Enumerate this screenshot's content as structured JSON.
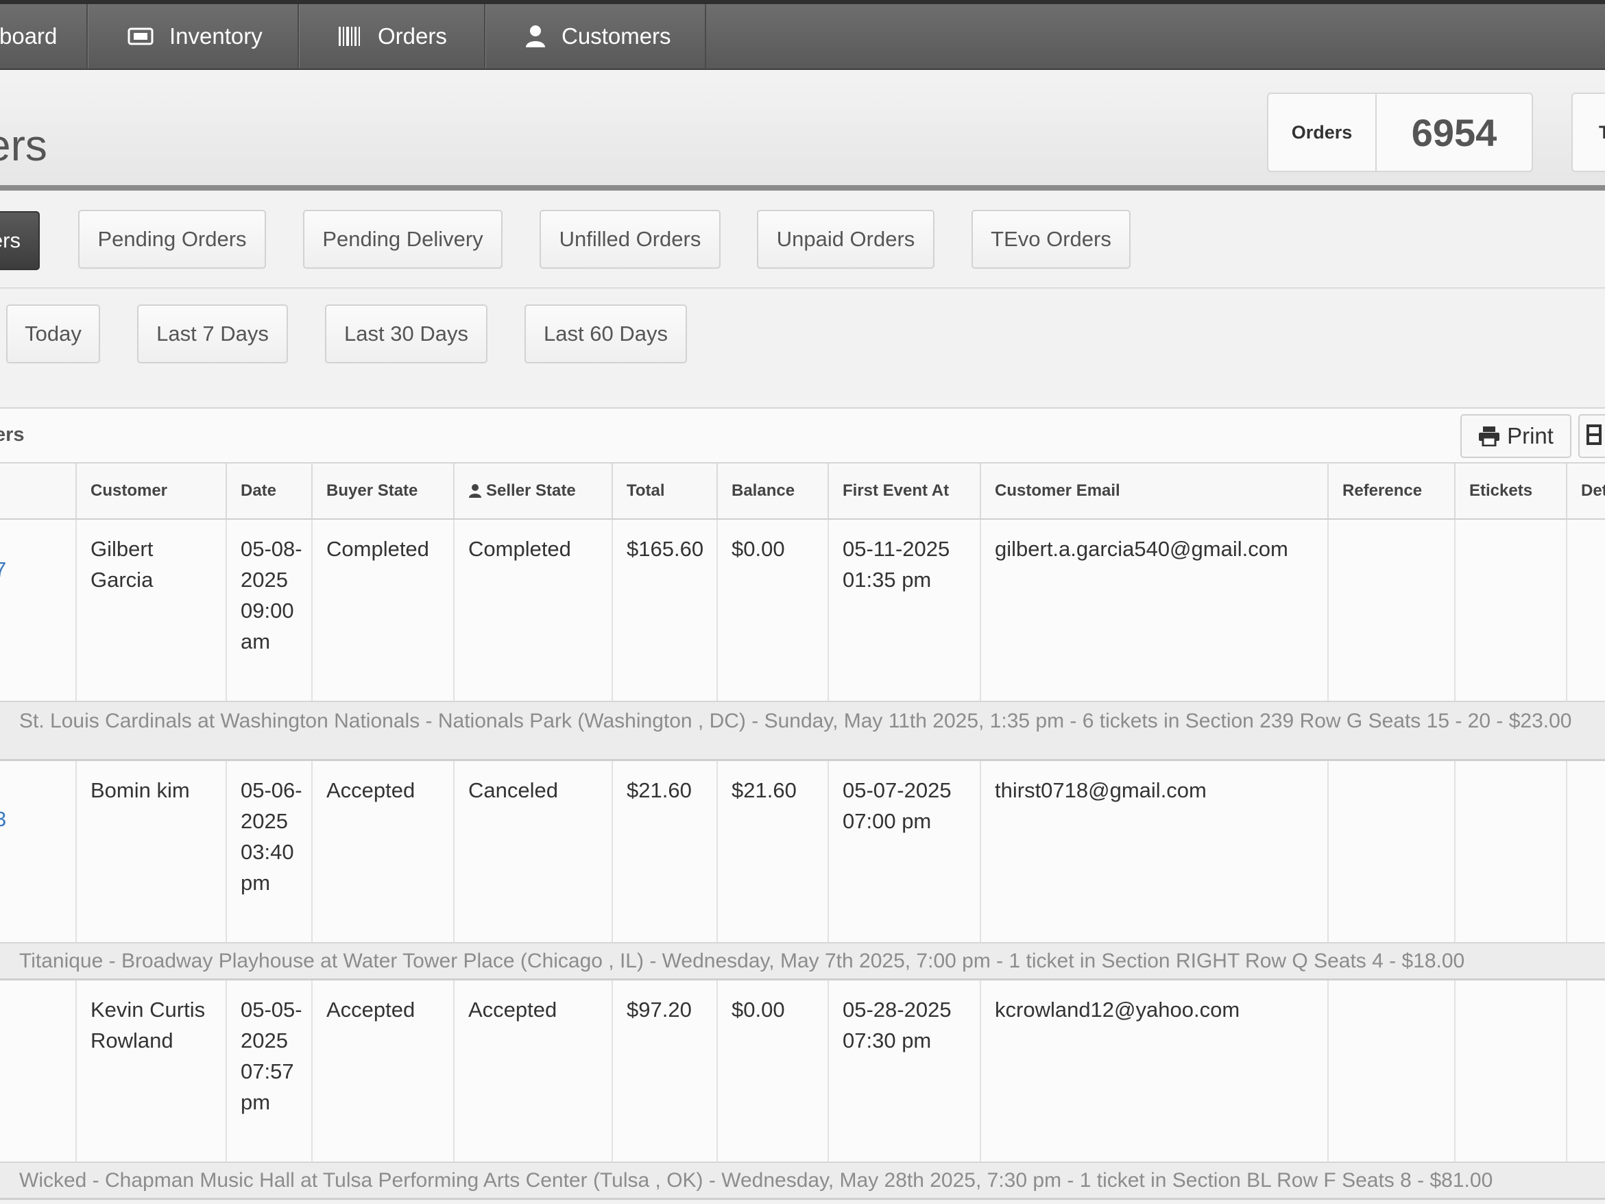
{
  "nav": {
    "items": [
      {
        "label": "board",
        "icon": ""
      },
      {
        "label": "Inventory",
        "icon": "ticket-icon"
      },
      {
        "label": "Orders",
        "icon": "barcode-icon"
      },
      {
        "label": "Customers",
        "icon": "user-icon"
      }
    ]
  },
  "header": {
    "title": "ers",
    "stats": [
      {
        "label": "Orders",
        "value": "6954"
      },
      {
        "label": "T",
        "value": ""
      }
    ]
  },
  "filters": {
    "status": [
      "ers",
      "Pending Orders",
      "Pending Delivery",
      "Unfilled Orders",
      "Unpaid Orders",
      "TEvo Orders"
    ],
    "range": [
      "Today",
      "Last 7 Days",
      "Last 30 Days",
      "Last 60 Days"
    ]
  },
  "panel": {
    "title": "ers",
    "print_label": "Print"
  },
  "table": {
    "columns": [
      "Customer",
      "Date",
      "Buyer State",
      "Seller State",
      "Total",
      "Balance",
      "First Event At",
      "Customer Email",
      "Reference",
      "Etickets",
      "Det"
    ],
    "rows": [
      {
        "id": "7",
        "customer": "Gilbert Garcia",
        "date": "05-08-2025 09:00 am",
        "buyer_state": "Completed",
        "seller_state": "Completed",
        "total": "$165.60",
        "balance": "$0.00",
        "first_event": "05-11-2025 01:35 pm",
        "email": "gilbert.a.garcia540@gmail.com",
        "detail": "St. Louis Cardinals at Washington Nationals  -  Nationals Park (Washington , DC)  -  Sunday, May 11th 2025, 1:35 pm  -  6 tickets in Section 239 Row G Seats 15 - 20  -  $23.00"
      },
      {
        "id": "3",
        "customer": "Bomin kim",
        "date": "05-06-2025 03:40 pm",
        "buyer_state": "Accepted",
        "seller_state": "Canceled",
        "total": "$21.60",
        "balance": "$21.60",
        "first_event": "05-07-2025 07:00 pm",
        "email": "thirst0718@gmail.com",
        "detail": "Titanique  -  Broadway Playhouse at Water Tower Place (Chicago , IL)  -  Wednesday, May 7th 2025, 7:00 pm  -  1 ticket in Section RIGHT Row Q Seats 4  -  $18.00"
      },
      {
        "id": "",
        "customer": "Kevin Curtis Rowland",
        "date": "05-05-2025 07:57 pm",
        "buyer_state": "Accepted",
        "seller_state": "Accepted",
        "total": "$97.20",
        "balance": "$0.00",
        "first_event": "05-28-2025 07:30 pm",
        "email": "kcrowland12@yahoo.com",
        "detail": "Wicked  -  Chapman Music Hall at Tulsa Performing Arts Center (Tulsa , OK)  -  Wednesday, May 28th 2025, 7:30 pm  -  1 ticket in Section BL Row F Seats 8  -  $81.00"
      }
    ]
  }
}
